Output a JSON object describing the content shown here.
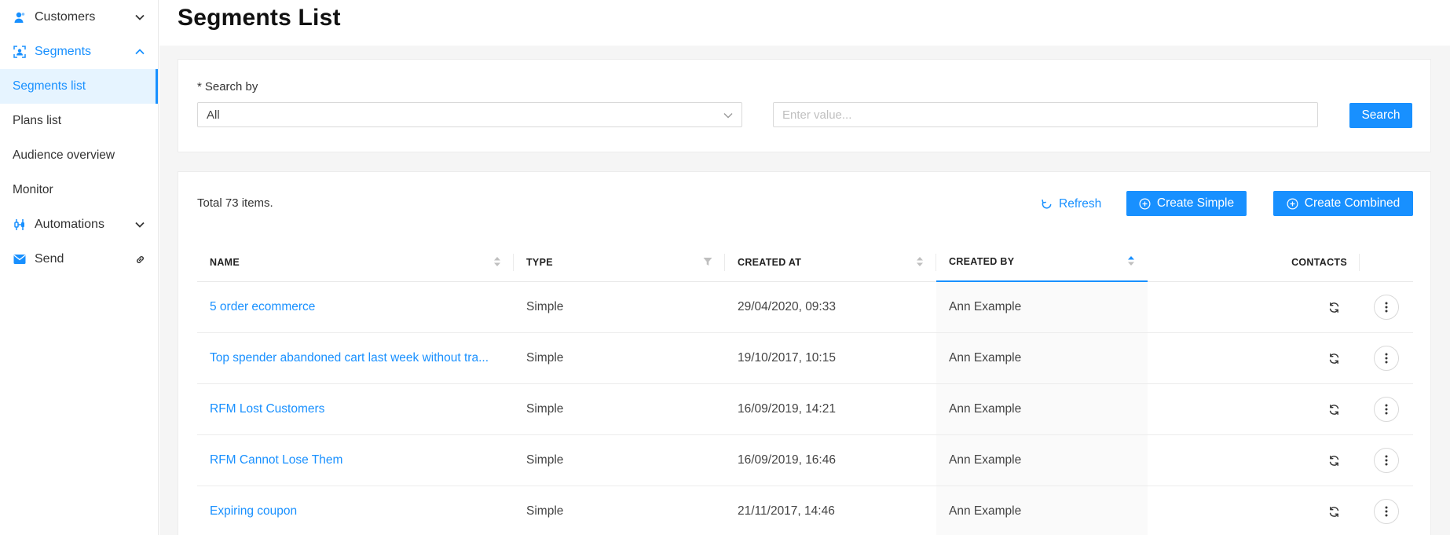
{
  "sidebar": {
    "groups": {
      "customers": "Customers",
      "segments": "Segments",
      "automations": "Automations",
      "send": "Send"
    },
    "segments_items": [
      "Segments list",
      "Plans list",
      "Audience overview",
      "Monitor"
    ]
  },
  "page": {
    "title": "Segments List"
  },
  "search": {
    "required_mark": "*",
    "label": "Search by",
    "select_value": "All",
    "input_placeholder": "Enter value...",
    "button": "Search"
  },
  "toolbar": {
    "total": "Total 73 items.",
    "refresh": "Refresh",
    "create_simple": "Create Simple",
    "create_combined": "Create Combined"
  },
  "table": {
    "columns": {
      "name": "NAME",
      "type": "TYPE",
      "created_at": "CREATED AT",
      "created_by": "CREATED BY",
      "contacts": "CONTACTS"
    },
    "rows": [
      {
        "name": "5 order ecommerce",
        "type": "Simple",
        "created_at": "29/04/2020, 09:33",
        "created_by": "Ann Example"
      },
      {
        "name": "Top spender abandoned cart last week without tra...",
        "type": "Simple",
        "created_at": "19/10/2017, 10:15",
        "created_by": "Ann Example"
      },
      {
        "name": "RFM Lost Customers",
        "type": "Simple",
        "created_at": "16/09/2019, 14:21",
        "created_by": "Ann Example"
      },
      {
        "name": "RFM Cannot Lose Them",
        "type": "Simple",
        "created_at": "16/09/2019, 16:46",
        "created_by": "Ann Example"
      },
      {
        "name": "Expiring coupon",
        "type": "Simple",
        "created_at": "21/11/2017, 14:46",
        "created_by": "Ann Example"
      }
    ]
  },
  "colors": {
    "accent": "#1890ff",
    "sorted_col_bg": "#fafafa"
  }
}
